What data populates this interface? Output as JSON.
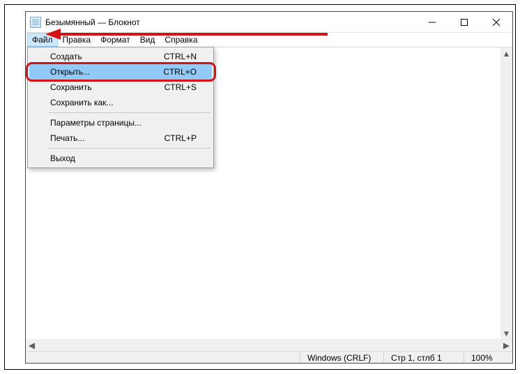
{
  "window": {
    "title": "Безымянный — Блокнот"
  },
  "menubar": {
    "items": [
      {
        "label": "Файл",
        "active": true
      },
      {
        "label": "Правка"
      },
      {
        "label": "Формат"
      },
      {
        "label": "Вид"
      },
      {
        "label": "Справка"
      }
    ]
  },
  "dropdown": {
    "items": [
      {
        "label": "Создать",
        "accel": "CTRL+N"
      },
      {
        "label": "Открыть...",
        "accel": "CTRL+O",
        "highlighted": true
      },
      {
        "label": "Сохранить",
        "accel": "CTRL+S"
      },
      {
        "label": "Сохранить как..."
      },
      {
        "sep": true
      },
      {
        "label": "Параметры страницы..."
      },
      {
        "label": "Печать...",
        "accel": "CTRL+P"
      },
      {
        "sep": true
      },
      {
        "label": "Выход"
      }
    ]
  },
  "statusbar": {
    "encoding": "Windows (CRLF)",
    "position": "Стр 1, стлб 1",
    "zoom": "100%"
  },
  "scroll": {
    "up": "▲",
    "down": "▼",
    "left": "◀",
    "right": "▶"
  }
}
